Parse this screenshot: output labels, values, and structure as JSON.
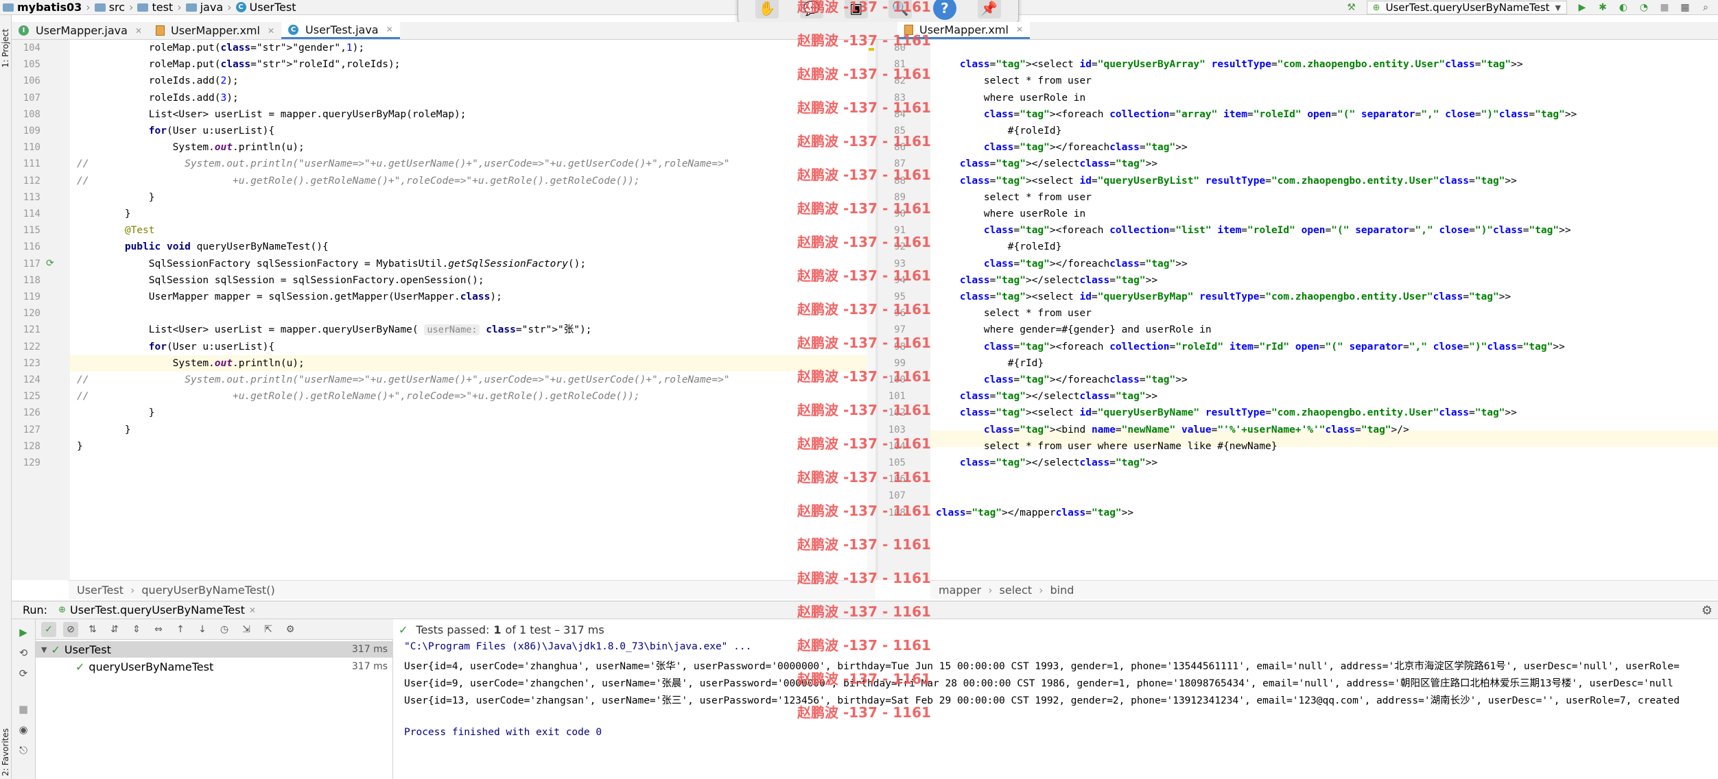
{
  "nav": {
    "project": "mybatis03",
    "path": [
      "src",
      "test",
      "java"
    ],
    "file": "UserTest",
    "run_config": "UserTest.queryUserByNameTest"
  },
  "side_labels": {
    "project": "1: Project",
    "favorites": "2: Favorites"
  },
  "left_tabs": [
    {
      "label": "UserMapper.java",
      "active": false,
      "icon": "interface-icon"
    },
    {
      "label": "UserMapper.xml",
      "active": false,
      "icon": "xml-file-icon"
    },
    {
      "label": "UserTest.java",
      "active": true,
      "icon": "class-icon"
    }
  ],
  "right_tabs": [
    {
      "label": "UserMapper.xml",
      "active": true,
      "icon": "xml-file-icon"
    }
  ],
  "left_editor": {
    "line_numbers": [
      "104",
      "105",
      "106",
      "107",
      "108",
      "109",
      "110",
      "111",
      "112",
      "113",
      "114",
      "115",
      "116",
      "117",
      "118",
      "119",
      "120",
      "121",
      "122",
      "123",
      "124",
      "125",
      "126",
      "127",
      "128",
      "129"
    ],
    "lines": [
      "            roleMap.put(\"gender\",1);",
      "            roleMap.put(\"roleId\",roleIds);",
      "            roleIds.add(2);",
      "            roleIds.add(3);",
      "            List<User> userList = mapper.queryUserByMap(roleMap);",
      "            for(User u:userList){",
      "                System.out.println(u);",
      "//                System.out.println(\"userName=>\"+u.getUserName()+\",userCode=>\"+u.getUserCode()+\",roleName=>\"",
      "//                        +u.getRole().getRoleName()+\",roleCode=>\"+u.getRole().getRoleCode());",
      "            }",
      "        }",
      "        @Test",
      "        public void queryUserByNameTest(){",
      "            SqlSessionFactory sqlSessionFactory = MybatisUtil.getSqlSessionFactory();",
      "            SqlSession sqlSession = sqlSessionFactory.openSession();",
      "            UserMapper mapper = sqlSession.getMapper(UserMapper.class);",
      "",
      "            List<User> userList = mapper.queryUserByName( userName: \"张\");",
      "            for(User u:userList){",
      "                System.out.println(u);",
      "//                System.out.println(\"userName=>\"+u.getUserName()+\",userCode=>\"+u.getUserCode()+\",roleName=>\"",
      "//                        +u.getRole().getRoleName()+\",roleCode=>\"+u.getRole().getRoleCode());",
      "            }",
      "        }",
      "}",
      ""
    ],
    "breadcrumb": [
      "UserTest",
      "queryUserByNameTest()"
    ]
  },
  "right_editor": {
    "line_numbers": [
      "80",
      "81",
      "82",
      "83",
      "84",
      "85",
      "86",
      "87",
      "88",
      "89",
      "90",
      "91",
      "92",
      "93",
      "94",
      "95",
      "96",
      "97",
      "98",
      "99",
      "100",
      "101",
      "102",
      "103",
      "104",
      "105",
      "106",
      "107",
      "108"
    ],
    "lines": [
      "",
      "    <select id=\"queryUserByArray\" resultType=\"com.zhaopengbo.entity.User\">",
      "        select * from user",
      "        where userRole in",
      "        <foreach collection=\"array\" item=\"roleId\" open=\"(\" separator=\",\" close=\")\">",
      "            #{roleId}",
      "        </foreach>",
      "    </select>",
      "    <select id=\"queryUserByList\" resultType=\"com.zhaopengbo.entity.User\">",
      "        select * from user",
      "        where userRole in",
      "        <foreach collection=\"list\" item=\"roleId\" open=\"(\" separator=\",\" close=\")\">",
      "            #{roleId}",
      "        </foreach>",
      "    </select>",
      "    <select id=\"queryUserByMap\" resultType=\"com.zhaopengbo.entity.User\">",
      "        select * from user",
      "        where gender=#{gender} and userRole in",
      "        <foreach collection=\"roleId\" item=\"rId\" open=\"(\" separator=\",\" close=\")\">",
      "            #{rId}",
      "        </foreach>",
      "    </select>",
      "    <select id=\"queryUserByName\" resultType=\"com.zhaopengbo.entity.User\">",
      "        <bind name=\"newName\" value=\"'%'+userName+'%'\"/>",
      "        select * from user where userName like #{newName}",
      "    </select>",
      "",
      "",
      "</mapper>"
    ],
    "breadcrumb": [
      "mapper",
      "select",
      "bind"
    ]
  },
  "run": {
    "label": "Run:",
    "tab": "UserTest.queryUserByNameTest",
    "status_prefix": "Tests passed:",
    "status_count": "1",
    "status_suffix": "of 1 test – 317 ms",
    "tree": [
      {
        "label": "UserTest",
        "time": "317 ms"
      },
      {
        "label": "queryUserByNameTest",
        "time": "317 ms"
      }
    ],
    "console": [
      "\"C:\\Program Files (x86)\\Java\\jdk1.8.0_73\\bin\\java.exe\" ...",
      "User{id=4, userCode='zhanghua', userName='张华', userPassword='0000000', birthday=Tue Jun 15 00:00:00 CST 1993, gender=1, phone='13544561111', email='null', address='北京市海淀区学院路61号', userDesc='null', userRole=",
      "User{id=9, userCode='zhangchen', userName='张晨', userPassword='0000000', birthday=Fri Mar 28 00:00:00 CST 1986, gender=1, phone='18098765434', email='null', address='朝阳区管庄路口北柏林爱乐三期13号楼', userDesc='null",
      "User{id=13, userCode='zhangsan', userName='张三', userPassword='123456', birthday=Sat Feb 29 00:00:00 CST 1992, gender=2, phone='13912341234', email='123@qq.com', address='湖南长沙', userDesc='', userRole=7, created",
      "",
      "Process finished with exit code 0"
    ]
  },
  "watermark": "赵鹏波 -137 - 1161",
  "colors": {
    "accent": "#4083c9",
    "pass_green": "#2e9a2e",
    "watermark": "#f05a5a",
    "current_line": "#fffae3"
  }
}
